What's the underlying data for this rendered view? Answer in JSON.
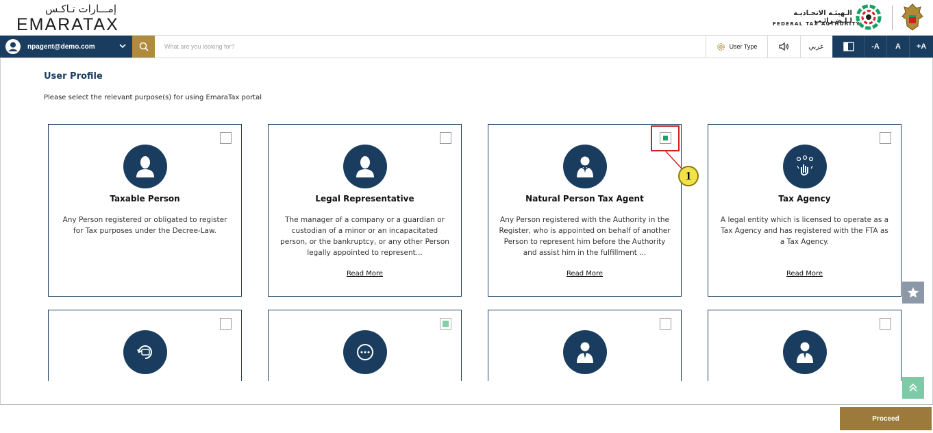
{
  "header": {
    "logo_ar": "إمـــارات تـاكـس",
    "logo_en": "EMARATAX",
    "fta_ar": "الـهيئـة الاتحـاديـة لـلـضـرائـب",
    "fta_en": "FEDERAL TAX AUTHORITY"
  },
  "toolbar": {
    "user_email": "npagent@demo.com",
    "search_placeholder": "What are you looking for?",
    "user_type_label": "User Type",
    "arabic_label": "عربي",
    "font_decrease": "-A",
    "font_normal": "A",
    "font_increase": "+A"
  },
  "page": {
    "title": "User Profile",
    "subtitle": "Please select the relevant purpose(s) for using EmaraTax portal"
  },
  "cards": [
    {
      "title": "Taxable Person",
      "desc": "Any Person registered or obligated to register for Tax purposes under the Decree-Law.",
      "more": "",
      "checked": false,
      "icon": "person-icon"
    },
    {
      "title": "Legal Representative",
      "desc": "The manager of a company or a guardian or custodian of a minor or an incapacitated person, or the bankruptcy, or any other Person legally appointed to represent...",
      "more": "Read More",
      "checked": false,
      "icon": "person-icon"
    },
    {
      "title": "Natural Person Tax Agent",
      "desc": "Any Person registered with the Authority in the Register, who is appointed on behalf of another Person to represent him before the Authority and assist him in the fulfillment ...",
      "more": "Read More",
      "checked": true,
      "icon": "business-person-icon"
    },
    {
      "title": "Tax Agency",
      "desc": "A legal entity which is licensed to operate as a Tax Agency and has registered with the FTA as a Tax Agency.",
      "more": "Read More",
      "checked": false,
      "icon": "hand-touch-icon"
    }
  ],
  "cards_row2": [
    {
      "checked": false,
      "icon": "refresh-card-icon"
    },
    {
      "checked": true,
      "icon": "more-dots-icon"
    },
    {
      "checked": false,
      "icon": "business-person-icon"
    },
    {
      "checked": false,
      "icon": "business-person-icon"
    }
  ],
  "callout": {
    "number": "1"
  },
  "footer": {
    "proceed_label": "Proceed"
  },
  "colors": {
    "navy": "#1a3c5e",
    "gold": "#b08a3e",
    "green": "#1aa064",
    "red": "#d21f1f"
  }
}
